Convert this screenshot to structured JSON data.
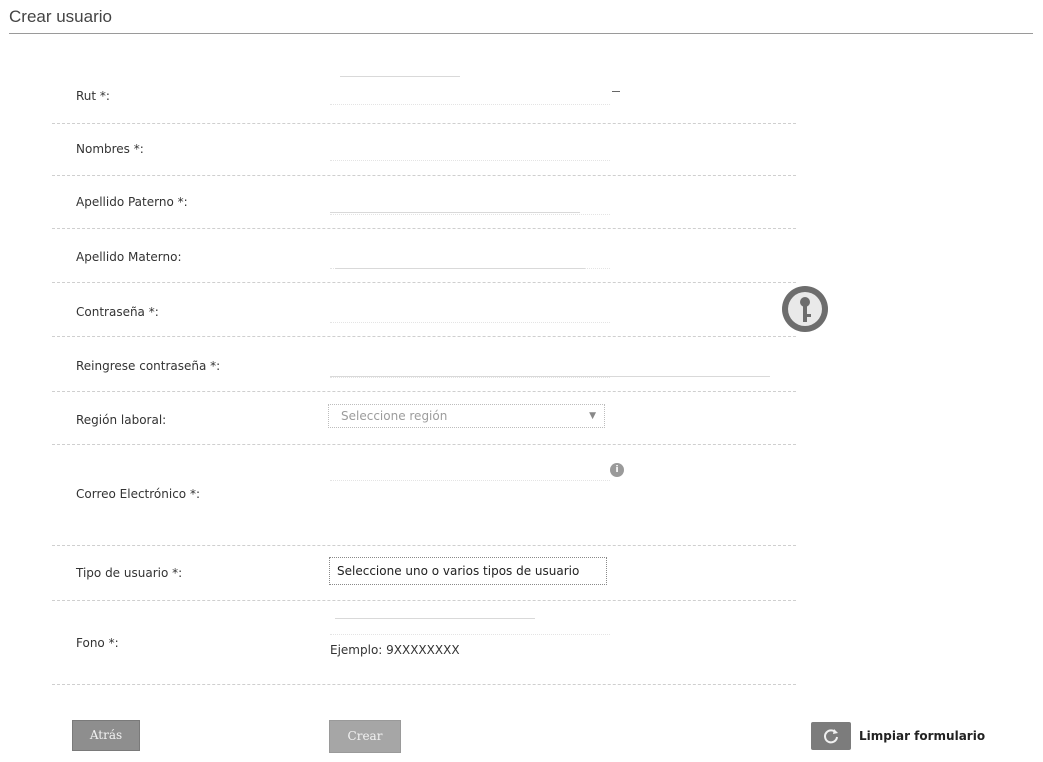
{
  "page": {
    "title": "Crear usuario"
  },
  "form": {
    "fields": [
      {
        "key": "rut",
        "label": "Rut *:"
      },
      {
        "key": "nombres",
        "label": "Nombres *:"
      },
      {
        "key": "apellido_paterno",
        "label": "Apellido Paterno *:"
      },
      {
        "key": "apellido_materno",
        "label": "Apellido Materno:"
      },
      {
        "key": "contrasena",
        "label": "Contraseña *:"
      },
      {
        "key": "reingrese_contrasena",
        "label": "Reingrese contraseña *:"
      },
      {
        "key": "region_laboral",
        "label": "Región laboral:",
        "placeholder": "Seleccione región"
      },
      {
        "key": "correo",
        "label": "Correo Electrónico *:"
      },
      {
        "key": "tipo_usuario",
        "label": "Tipo de usuario *:",
        "placeholder": "Seleccione uno o varios tipos de usuario"
      },
      {
        "key": "fono",
        "label": "Fono *:",
        "hint": "Ejemplo: 9XXXXXXXX"
      }
    ]
  },
  "icons": {
    "password_helper": "key-icon",
    "email_info": "info-icon",
    "clear_form": "refresh-icon"
  },
  "buttons": {
    "back": "Atrás",
    "create": "Crear",
    "clear": "Limpiar formulario"
  },
  "colors": {
    "button_gray": "#8e8e8e",
    "icon_gray": "#6d6d6d"
  }
}
